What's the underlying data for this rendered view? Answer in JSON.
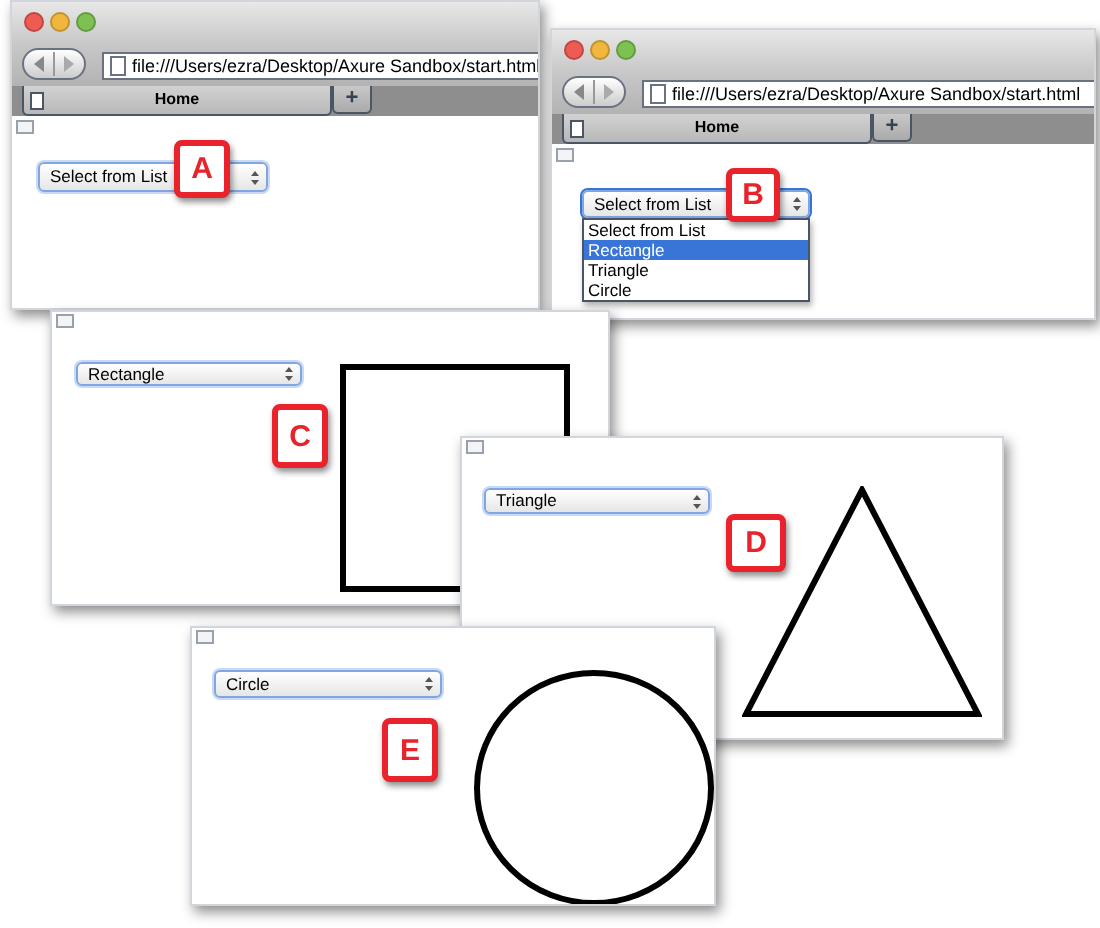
{
  "panels": [
    {
      "kind": "browser",
      "url": "file:///Users/ezra/Desktop/Axure Sandbox/start.html",
      "tab": "Home",
      "new_tab": "+",
      "select": {
        "value": "Select from List",
        "open": false
      },
      "callout": "A"
    },
    {
      "kind": "browser",
      "url": "file:///Users/ezra/Desktop/Axure Sandbox/start.html",
      "tab": "Home",
      "new_tab": "+",
      "select": {
        "value": "Select from List",
        "open": true,
        "options": [
          {
            "label": "Select from List",
            "highlighted": false
          },
          {
            "label": "Rectangle",
            "highlighted": true
          },
          {
            "label": "Triangle",
            "highlighted": false
          },
          {
            "label": "Circle",
            "highlighted": false
          }
        ]
      },
      "callout": "B"
    },
    {
      "kind": "page",
      "figure": {
        "kind": "rectangle"
      },
      "select": {
        "value": "Rectangle",
        "open": false
      },
      "callout": "C"
    },
    {
      "kind": "page",
      "figure": {
        "kind": "triangle"
      },
      "select": {
        "value": "Triangle",
        "open": false
      },
      "callout": "D"
    },
    {
      "kind": "page",
      "figure": {
        "kind": "circle"
      },
      "select": {
        "value": "Circle",
        "open": false
      },
      "callout": "E"
    }
  ]
}
